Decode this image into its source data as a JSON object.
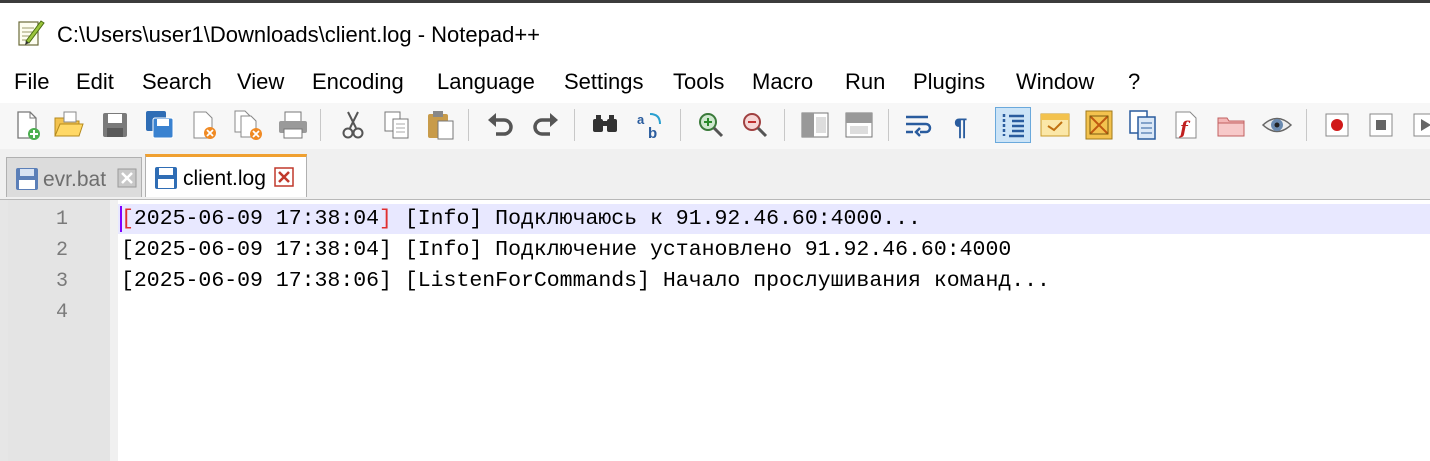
{
  "window": {
    "title": "C:\\Users\\user1\\Downloads\\client.log - Notepad++",
    "app_icon": "notepad-plus-plus-icon"
  },
  "menu": [
    "File",
    "Edit",
    "Search",
    "View",
    "Encoding",
    "Language",
    "Settings",
    "Tools",
    "Macro",
    "Run",
    "Plugins",
    "Window",
    "?"
  ],
  "toolbar": {
    "buttons": [
      "new-file-icon",
      "open-file-icon",
      "save-icon",
      "save-all-icon",
      "close-icon",
      "close-all-icon",
      "print-icon",
      "cut-icon",
      "copy-icon",
      "paste-icon",
      "undo-icon",
      "redo-icon",
      "find-icon",
      "replace-icon",
      "zoom-in-icon",
      "zoom-out-icon",
      "sync-vertical-icon",
      "sync-horizontal-icon",
      "word-wrap-icon",
      "show-all-characters-icon",
      "indent-guide-icon",
      "udl-icon",
      "document-map-icon",
      "document-list-icon",
      "function-list-icon",
      "folder-as-workspace-icon",
      "monitoring-icon",
      "record-macro-icon",
      "stop-recording-icon",
      "play-macro-icon"
    ],
    "active": "indent-guide-icon"
  },
  "tabs": [
    {
      "label": "evr.bat",
      "active": false,
      "icon": "disk-icon"
    },
    {
      "label": "client.log",
      "active": true,
      "icon": "disk-icon"
    }
  ],
  "editor": {
    "line_numbers": [
      "1",
      "2",
      "3",
      "4"
    ],
    "lines": [
      {
        "bracket_open": "[",
        "timestamp": "2025-06-09 17:38:04",
        "bracket_close": "]",
        "rest": " [Info] Подключаюсь к 91.92.46.60:4000..."
      },
      {
        "text": "[2025-06-09 17:38:04] [Info] Подключение установлено 91.92.46.60:4000"
      },
      {
        "text": "[2025-06-09 17:38:06] [ListenForCommands] Начало прослушивания команд..."
      },
      {
        "text": ""
      }
    ],
    "current_line_color": "#e8e8ff",
    "brace_match_color": "#e03030",
    "caret_color": "#8000ff"
  }
}
